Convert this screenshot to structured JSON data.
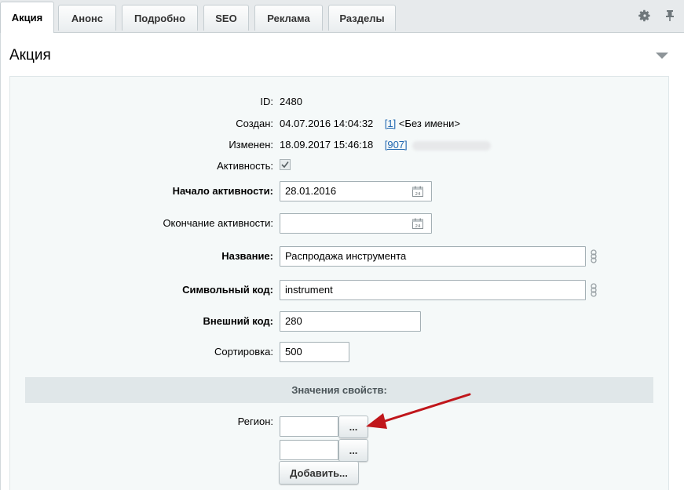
{
  "tabs": [
    {
      "label": "Акция",
      "active": true
    },
    {
      "label": "Анонс"
    },
    {
      "label": "Подробно"
    },
    {
      "label": "SEO"
    },
    {
      "label": "Реклама"
    },
    {
      "label": "Разделы"
    }
  ],
  "panel": {
    "title": "Акция"
  },
  "fields": {
    "id": {
      "label": "ID:",
      "value": "2480"
    },
    "created": {
      "label": "Создан:",
      "date": "04.07.2016 14:04:32",
      "user_link": "[1]",
      "user_name": "<Без имени>"
    },
    "modified": {
      "label": "Изменен:",
      "date": "18.09.2017 15:46:18",
      "user_link": "[907]"
    },
    "active": {
      "label": "Активность:",
      "checked": true
    },
    "active_from": {
      "label": "Начало активности:",
      "value": "28.01.2016"
    },
    "active_to": {
      "label": "Окончание активности:",
      "value": ""
    },
    "name": {
      "label": "Название:",
      "value": "Распродажа инструмента"
    },
    "code": {
      "label": "Символьный код:",
      "value": "instrument"
    },
    "external_code": {
      "label": "Внешний код:",
      "value": "280"
    },
    "sort": {
      "label": "Сортировка:",
      "value": "500"
    }
  },
  "properties": {
    "title": "Значения свойств:",
    "region": {
      "label": "Регион:",
      "values": [
        "",
        ""
      ],
      "browse_label": "...",
      "add_label": "Добавить..."
    }
  },
  "colors": {
    "accent_arrow": "#c0161b",
    "link": "#2067b0"
  }
}
